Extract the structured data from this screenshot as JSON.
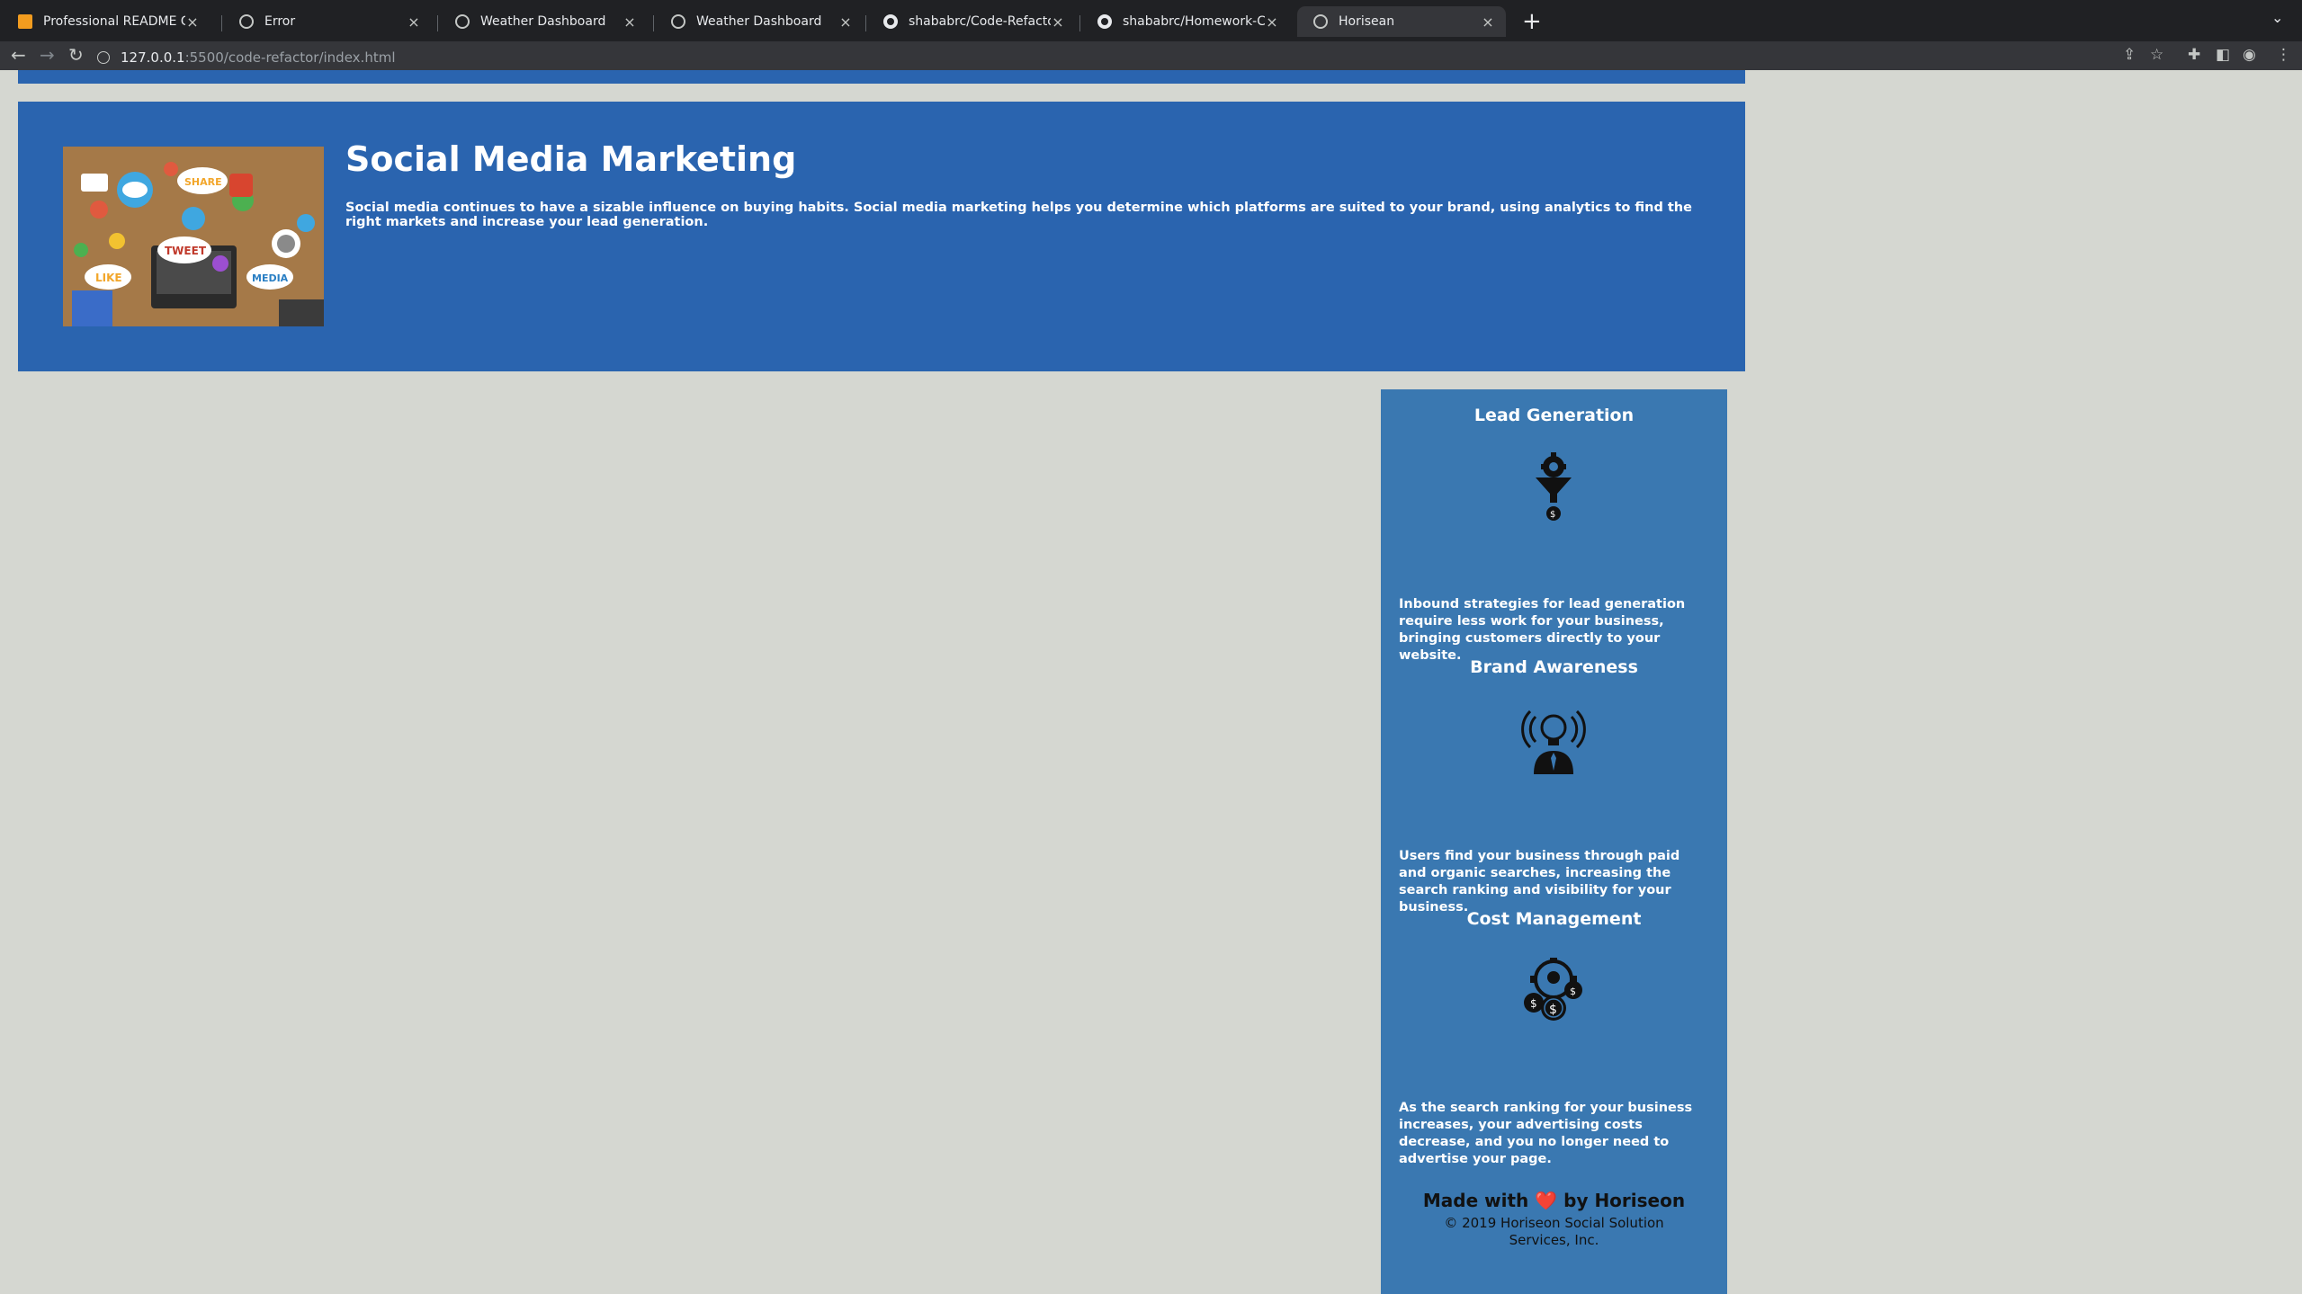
{
  "browser": {
    "tabs": [
      {
        "title": "Professional README Guide | T",
        "icon": "orange-square-icon"
      },
      {
        "title": "Error",
        "icon": "globe-icon"
      },
      {
        "title": "Weather Dashboard",
        "icon": "globe-icon"
      },
      {
        "title": "Weather Dashboard",
        "icon": "globe-icon"
      },
      {
        "title": "shababrc/Code-Refactor: Our I",
        "icon": "github-icon"
      },
      {
        "title": "shababrc/Homework-Challeng",
        "icon": "github-icon"
      },
      {
        "title": "Horisean",
        "icon": "globe-icon"
      }
    ],
    "active_tab": 6,
    "url_host": "127.0.0.1",
    "url_rest": ":5500/code-refactor/index.html"
  },
  "hero": {
    "title": "Social Media Marketing",
    "text": "Social media continues to have a sizable influence on buying habits. Social media marketing helps you determine which platforms are suited to your brand, using analytics to find the right markets and increase your lead generation.",
    "image_labels": [
      "SHARE",
      "TWEET",
      "LIKE",
      "MEDIA"
    ]
  },
  "benefits": [
    {
      "title": "Lead Generation",
      "icon": "funnel-gear-icon",
      "text": "Inbound strategies for lead generation require less work for your business, bringing customers directly to your website."
    },
    {
      "title": "Brand Awareness",
      "icon": "lightbulb-person-icon",
      "text": "Users find your business through paid and organic searches, increasing the search ranking and visibility for your business."
    },
    {
      "title": "Cost Management",
      "icon": "gear-coins-icon",
      "text": "As the search ranking for your business increases, your advertising costs decrease, and you no longer need to advertise your page."
    }
  ],
  "footer": {
    "made_prefix": "Made with",
    "heart": "❤️",
    "made_suffix": "by Horiseon",
    "copyright": "© 2019 Horiseon Social Solution Services, Inc."
  },
  "colors": {
    "hero_bg": "#2a64af",
    "aside_bg": "#3a78b1",
    "page_bg": "#d5d7d1"
  }
}
